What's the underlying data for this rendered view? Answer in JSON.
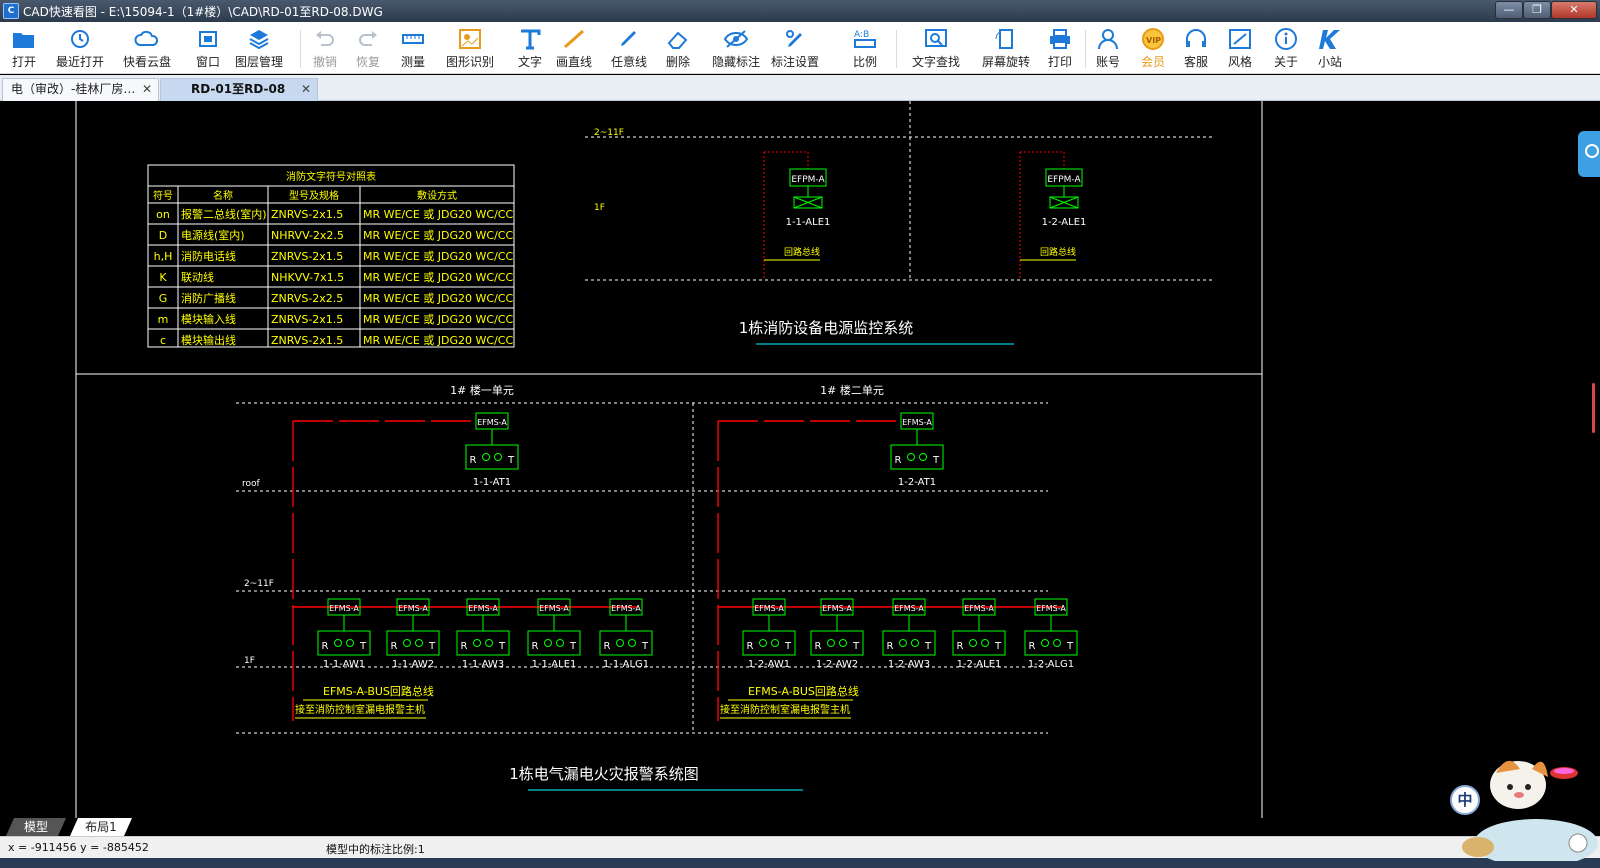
{
  "window": {
    "title": "CAD快速看图 - E:\\15094-1（1#楼）\\CAD\\RD-01至RD-08.DWG",
    "app_icon": "cad-icon",
    "min_label": "—",
    "max_label": "❐",
    "close_label": "✕"
  },
  "toolbar": [
    {
      "name": "open",
      "label": "打开",
      "icon": "folder-open-icon",
      "enabled": true
    },
    {
      "name": "recent",
      "label": "最近打开",
      "icon": "clock-icon",
      "enabled": true
    },
    {
      "name": "cloud",
      "label": "快看云盘",
      "icon": "cloud-icon",
      "enabled": true
    },
    {
      "name": "window",
      "label": "窗口",
      "icon": "window-icon",
      "enabled": true
    },
    {
      "name": "layers",
      "label": "图层管理",
      "icon": "layers-icon",
      "enabled": true
    },
    {
      "name": "undo",
      "label": "撤销",
      "icon": "undo-icon",
      "enabled": false
    },
    {
      "name": "redo",
      "label": "恢复",
      "icon": "redo-icon",
      "enabled": false
    },
    {
      "name": "measure",
      "label": "测量",
      "icon": "ruler-icon",
      "enabled": true
    },
    {
      "name": "shape-recognize",
      "label": "图形识别",
      "icon": "shape-recognize-icon",
      "enabled": true
    },
    {
      "name": "text",
      "label": "文字",
      "icon": "text-icon",
      "enabled": true
    },
    {
      "name": "line",
      "label": "画直线",
      "icon": "line-icon",
      "enabled": true
    },
    {
      "name": "freehand",
      "label": "任意线",
      "icon": "pen-icon",
      "enabled": true
    },
    {
      "name": "delete",
      "label": "删除",
      "icon": "eraser-icon",
      "enabled": true
    },
    {
      "name": "hide-annotations",
      "label": "隐藏标注",
      "icon": "eye-hidden-icon",
      "enabled": true
    },
    {
      "name": "annotation-settings",
      "label": "标注设置",
      "icon": "settings-pen-icon",
      "enabled": true
    },
    {
      "name": "scale",
      "label": "比例",
      "icon": "ratio-icon",
      "enabled": true
    },
    {
      "name": "text-search",
      "label": "文字查找",
      "icon": "text-search-icon",
      "enabled": true
    },
    {
      "name": "rotate-screen",
      "label": "屏幕旋转",
      "icon": "rotate-screen-icon",
      "enabled": true
    },
    {
      "name": "print",
      "label": "打印",
      "icon": "printer-icon",
      "enabled": true
    },
    {
      "name": "account",
      "label": "账号",
      "icon": "user-icon",
      "enabled": true
    },
    {
      "name": "vip",
      "label": "会员",
      "icon": "vip-icon",
      "enabled": true
    },
    {
      "name": "support",
      "label": "客服",
      "icon": "headset-icon",
      "enabled": true
    },
    {
      "name": "style",
      "label": "风格",
      "icon": "style-icon",
      "enabled": true
    },
    {
      "name": "about",
      "label": "关于",
      "icon": "info-icon",
      "enabled": true
    },
    {
      "name": "site",
      "label": "小站",
      "icon": "k-logo-icon",
      "enabled": true
    }
  ],
  "tabs": [
    {
      "label": "电（审改）-桂林厂房…",
      "active": false,
      "close": "✕"
    },
    {
      "label": "RD-01至RD-08",
      "active": true,
      "close": "✕"
    }
  ],
  "drawing": {
    "table": {
      "title": "消防文字符号对照表",
      "headers": [
        "符号",
        "名称",
        "型号及规格",
        "敷设方式"
      ],
      "rows": [
        [
          "on",
          "报警二总线(室内)",
          "ZNRVS-2x1.5",
          "MR WE/CE 或 JDG20 WC/CC"
        ],
        [
          "D",
          "电源线(室内)",
          "NHRVV-2x2.5",
          "MR WE/CE 或 JDG20 WC/CC"
        ],
        [
          "h,H",
          "消防电话线",
          "ZNRVS-2x1.5",
          "MR WE/CE 或 JDG20 WC/CC"
        ],
        [
          "K",
          "联动线",
          "NHKVV-7x1.5",
          "MR WE/CE 或 JDG20 WC/CC"
        ],
        [
          "G",
          "消防广播线",
          "ZNRVS-2x2.5",
          "MR WE/CE 或 JDG20 WC/CC"
        ],
        [
          "m",
          "模块输入线",
          "ZNRVS-2x1.5",
          "MR WE/CE 或 JDG20 WC/CC"
        ],
        [
          "c",
          "模块输出线",
          "ZNRVS-2x1.5",
          "MR WE/CE 或 JDG20 WC/CC"
        ]
      ]
    },
    "power_monitor": {
      "floor_labels": [
        "2~11F",
        "1F"
      ],
      "devices": [
        {
          "module": "EFPM-A",
          "label": "1-1-ALE1",
          "bus": "回路总线"
        },
        {
          "module": "EFPM-A",
          "label": "1-2-ALE1",
          "bus": "回路总线"
        }
      ],
      "title": "1栋消防设备电源监控系统"
    },
    "leakage_alarm": {
      "units": [
        {
          "title": "1# 楼一单元",
          "top_module": "EFMS-A",
          "top_label": "1-1-AT1",
          "modules": [
            "EFMS-A",
            "EFMS-A",
            "EFMS-A",
            "EFMS-A",
            "EFMS-A"
          ],
          "labels": [
            "1-1-AW1",
            "1-1-AW2",
            "1-1-AW3",
            "1-1-ALE1",
            "1-1-ALG1"
          ],
          "bus_label": "EFMS-A-BUS回路总线",
          "bus_note": "接至消防控制室漏电报警主机"
        },
        {
          "title": "1# 楼二单元",
          "top_module": "EFMS-A",
          "top_label": "1-2-AT1",
          "modules": [
            "EFMS-A",
            "EFMS-A",
            "EFMS-A",
            "EFMS-A",
            "EFMS-A"
          ],
          "labels": [
            "1-2-AW1",
            "1-2-AW2",
            "1-2-AW3",
            "1-2-ALE1",
            "1-2-ALG1"
          ],
          "bus_label": "EFMS-A-BUS回路总线",
          "bus_note": "接至消防控制室漏电报警主机"
        }
      ],
      "floor_labels": [
        "roof",
        "2~11F",
        "1F"
      ],
      "terminal_r": "R",
      "terminal_t": "T",
      "title": "1栋电气漏电火灾报警系统图"
    }
  },
  "layout_tabs": [
    "模型",
    "布局1"
  ],
  "status": {
    "coords": "x = -911456  y = -885452",
    "scale_text": "模型中的标注比例:1"
  },
  "colors": {
    "cad_background": "#000000",
    "yellow": "#ffff00",
    "green": "#00ff00",
    "red": "#ff0000",
    "cyan": "#00ffff",
    "white": "#ffffff",
    "toolbar_icon": "#1e7ad8"
  },
  "mascot": {
    "ime_label": "中"
  }
}
